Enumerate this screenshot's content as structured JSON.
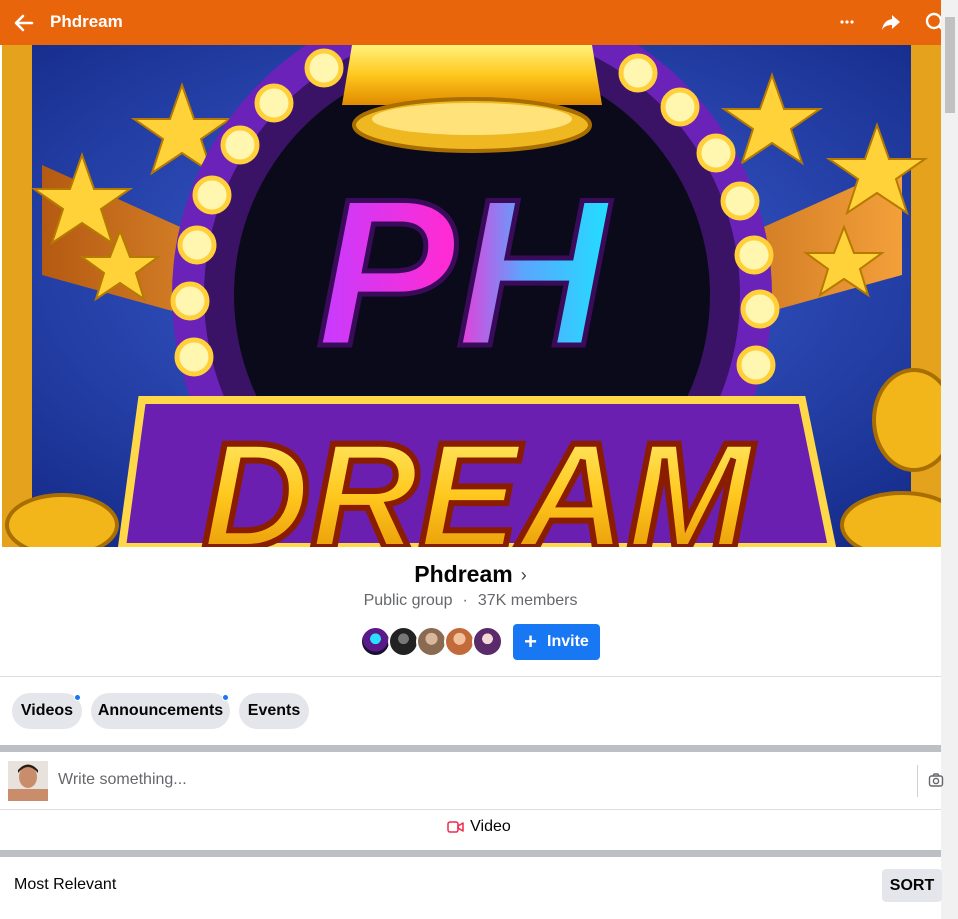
{
  "header": {
    "title": "Phdream",
    "back_icon": "arrow-left-icon",
    "more_icon": "more-horizontal-icon",
    "share_icon": "share-arrow-icon",
    "search_icon": "search-icon",
    "background": "#e8650c"
  },
  "cover": {
    "logo_line1": "PH",
    "logo_line2": "DREAM"
  },
  "group": {
    "name": "Phdream",
    "privacy": "Public group",
    "separator": "·",
    "members": "37K members",
    "invite_label": "Invite"
  },
  "tabs": [
    {
      "label": "Videos",
      "has_dot": true
    },
    {
      "label": "Announcements",
      "has_dot": true
    },
    {
      "label": "Events",
      "has_dot": false
    }
  ],
  "composer": {
    "placeholder": "Write something...",
    "video_label": "Video"
  },
  "feed": {
    "sort_label": "Most Relevant",
    "sort_button": "SORT"
  },
  "colors": {
    "accent": "#1877f2",
    "chip_bg": "#e4e6eb",
    "secondary_text": "#65676b"
  }
}
